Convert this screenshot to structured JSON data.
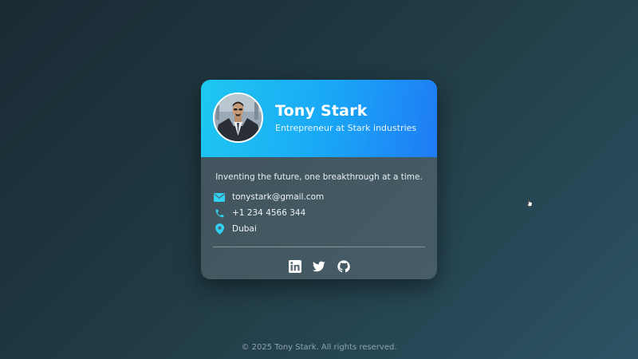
{
  "profile": {
    "name": "Tony Stark",
    "title": "Entrepreneur at Stark industries",
    "tagline": "Inventing the future, one breakthrough at a time."
  },
  "contact": {
    "email": "tonystark@gmail.com",
    "phone": "+1 234 4566 344",
    "location": "Dubai"
  },
  "social": [
    {
      "name": "linkedin-icon"
    },
    {
      "name": "twitter-icon"
    },
    {
      "name": "github-icon"
    }
  ],
  "footer": {
    "text": "© 2025 Tony Stark. All rights reserved."
  },
  "colors": {
    "header_start": "#1fc8f0",
    "header_end": "#1f7bf5",
    "accent": "#2fd0f0"
  }
}
